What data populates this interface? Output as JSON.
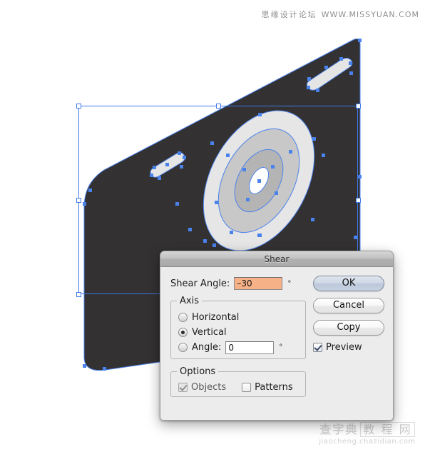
{
  "watermarks": {
    "top_cn": "思缘设计论坛",
    "top_url": "WWW.MISSYUAN.COM",
    "bottom_cn_1": "查字典",
    "bottom_cn_2": "教 程 网",
    "bottom_url": "jiaocheng.chazidian.com"
  },
  "canvas": {
    "artwork_name": "sheared-camera-illustration",
    "body_color": "#333132",
    "lens_outer_color": "#e3e3e3",
    "lens_mid_color": "#c9c9c9",
    "lens_inner_color": "#b3b3b3",
    "highlight_color": "#ffffff",
    "slab_color": "#e5e5e5",
    "selection_color": "#3f79e8",
    "anchor_color": "#4a82ec"
  },
  "dialog": {
    "title": "Shear",
    "shear_angle": {
      "label": "Shear Angle:",
      "value": "–30",
      "unit": "°"
    },
    "axis": {
      "legend": "Axis",
      "options": [
        {
          "label": "Horizontal",
          "selected": false
        },
        {
          "label": "Vertical",
          "selected": true
        },
        {
          "label": "Angle:",
          "selected": false
        }
      ],
      "angle_value": "0",
      "angle_unit": "°"
    },
    "options": {
      "legend": "Options",
      "objects": {
        "label": "Objects",
        "checked": true,
        "enabled": false
      },
      "patterns": {
        "label": "Patterns",
        "checked": false,
        "enabled": true
      }
    },
    "buttons": {
      "ok": "OK",
      "cancel": "Cancel",
      "copy": "Copy"
    },
    "preview": {
      "label": "Preview",
      "checked": true
    }
  }
}
